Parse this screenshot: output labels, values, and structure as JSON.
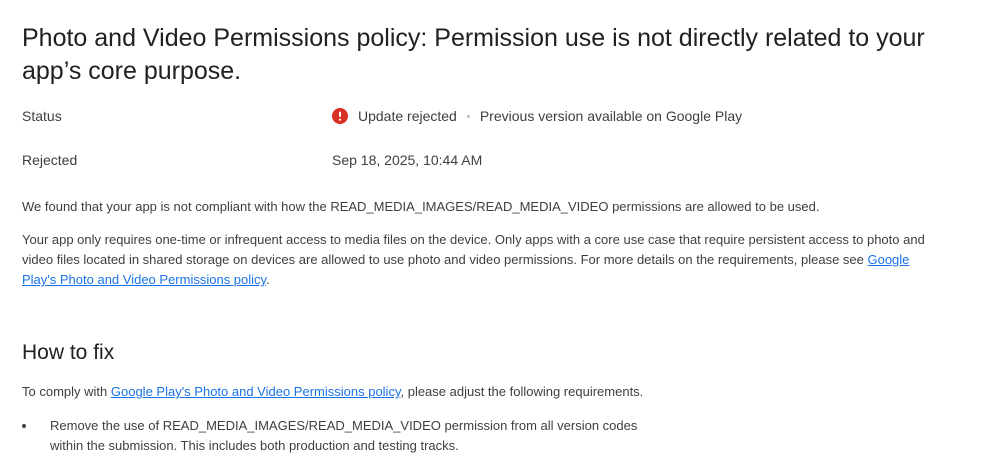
{
  "title": "Photo and Video Permissions policy: Permission use is not directly related to your app’s core purpose.",
  "status": {
    "label": "Status",
    "value": "Update rejected",
    "secondary": "Previous version available on Google Play",
    "icon": "alert-circle-icon",
    "icon_color": "#d93025"
  },
  "rejected": {
    "label": "Rejected",
    "value": "Sep 18, 2025, 10:44 AM"
  },
  "paragraphs": {
    "p1": "We found that your app is not compliant with how the READ_MEDIA_IMAGES/READ_MEDIA_VIDEO permissions are allowed to be used.",
    "p2_text": "Your app only requires one-time or infrequent access to media files on the device. Only apps with a core use case that require persistent access to photo and video files located in shared storage on devices are allowed to use photo and video permissions. For more details on the requirements, please see ",
    "p2_link": "Google Play's Photo and Video Permissions policy",
    "p2_end": "."
  },
  "how_to_fix": {
    "heading": "How to fix",
    "intro_before": "To comply with ",
    "intro_link": "Google Play's Photo and Video Permissions policy",
    "intro_after": ", please adjust the following requirements.",
    "bullets": [
      "Remove the use of READ_MEDIA_IMAGES/READ_MEDIA_VIDEO permission from all version codes within the submission. This includes both production and testing tracks."
    ]
  },
  "colors": {
    "link": "#1a73e8",
    "text": "#3c4043",
    "heading": "#202124",
    "error": "#d93025"
  }
}
